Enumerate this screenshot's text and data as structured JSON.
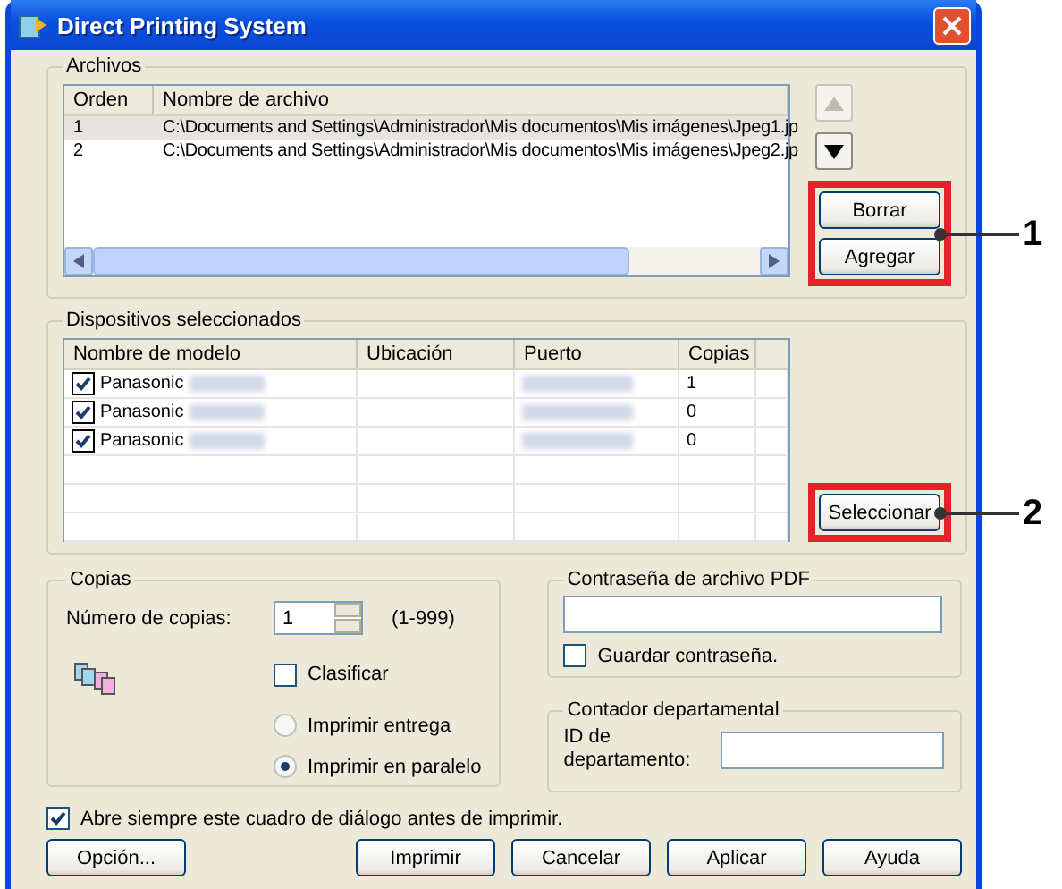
{
  "window": {
    "title": "Direct Printing System"
  },
  "files": {
    "label": "Archivos",
    "columns": [
      "Orden",
      "Nombre de archivo"
    ],
    "rows": [
      {
        "order": "1",
        "path": "C:\\Documents and Settings\\Administrador\\Mis documentos\\Mis imágenes\\Jpeg1.jp",
        "selected": true
      },
      {
        "order": "2",
        "path": "C:\\Documents and Settings\\Administrador\\Mis documentos\\Mis imágenes\\Jpeg2.jp",
        "selected": false
      }
    ],
    "move_up": {
      "disabled": true
    },
    "move_down": {
      "disabled": false
    },
    "buttons": [
      "Borrar",
      "Agregar"
    ],
    "callout": "1"
  },
  "devices": {
    "label": "Dispositivos seleccionados",
    "columns": [
      "Nombre de modelo",
      "Ubicación",
      "Puerto",
      "Copias"
    ],
    "rows": [
      {
        "checked": true,
        "name": "Panasonic",
        "copies": "1"
      },
      {
        "checked": true,
        "name": "Panasonic",
        "copies": "0"
      },
      {
        "checked": true,
        "name": "Panasonic",
        "copies": "0"
      }
    ],
    "select_button": "Seleccionar",
    "callout": "2"
  },
  "copies": {
    "label": "Copias",
    "count_label": "Número de copias:",
    "value": "1",
    "range": "(1-999)",
    "collate": {
      "label": "Clasificar",
      "checked": false
    },
    "options": [
      {
        "label": "Imprimir entrega",
        "selected": false
      },
      {
        "label": "Imprimir en paralelo",
        "selected": true
      }
    ]
  },
  "pdf_password": {
    "label": "Contraseña de archivo PDF",
    "save": {
      "label": "Guardar contraseña.",
      "checked": false
    }
  },
  "department": {
    "label": "Contador departamental",
    "id_label": "ID de departamento:"
  },
  "always_show": {
    "label": "Abre siempre este cuadro de diálogo antes de imprimir.",
    "checked": true
  },
  "buttons": [
    "Opción...",
    "Imprimir",
    "Cancelar",
    "Aplicar",
    "Ayuda"
  ]
}
